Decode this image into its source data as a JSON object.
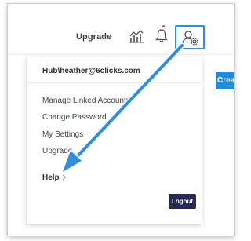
{
  "header": {
    "upgrade_label": "Upgrade",
    "analytics_icon": "bar-chart-icon",
    "notification_icon": "bell-icon",
    "user_settings_icon": "user-gear-icon",
    "highlight_color": "#2f8ee0",
    "notification_dot_color": "#e0403a"
  },
  "create_button_fragment": {
    "label": "Create"
  },
  "dropdown": {
    "account": "Hub\\heather@6clicks.com",
    "items": [
      {
        "label": "Manage Linked Accounts"
      },
      {
        "label": "Change Password"
      },
      {
        "label": "My Settings"
      },
      {
        "label": "Upgrade"
      }
    ],
    "help_label": "Help",
    "logout_label": "Logout",
    "logout_color": "#262a55"
  },
  "annotation": {
    "arrow_color": "#2f8ee0"
  }
}
